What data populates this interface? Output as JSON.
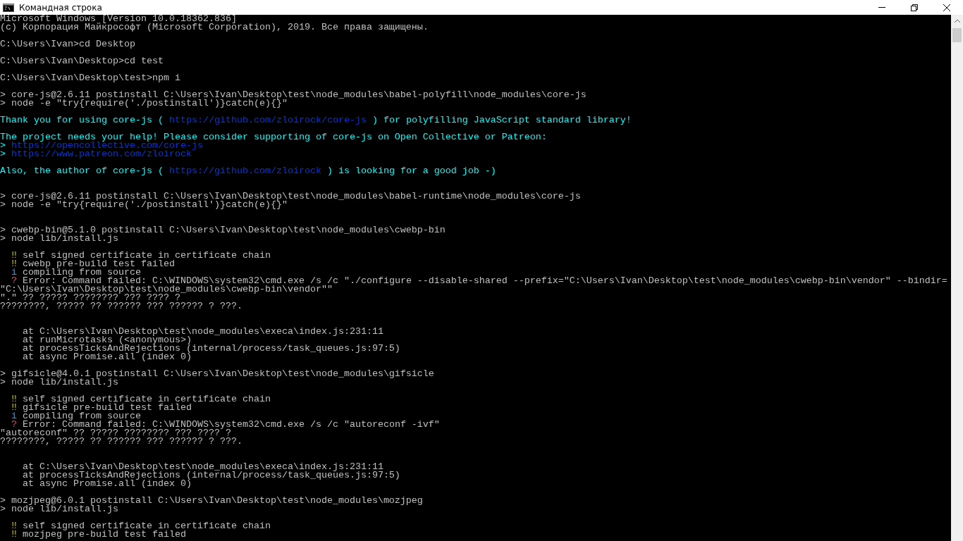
{
  "window": {
    "title": "Командная строка"
  },
  "console": {
    "lines": [
      {
        "kind": "text",
        "segments": [
          {
            "kind": "plain",
            "text": "Microsoft Windows [Version 10.0.18362.836]"
          }
        ]
      },
      {
        "kind": "text",
        "segments": [
          {
            "kind": "plain",
            "text": "(c) Корпорация Майкрософт (Microsoft Corporation), 2019. Все права защищены."
          }
        ]
      },
      {
        "kind": "blank"
      },
      {
        "kind": "text",
        "segments": [
          {
            "kind": "plain",
            "text": "C:\\Users\\Ivan>cd Desktop"
          }
        ]
      },
      {
        "kind": "blank"
      },
      {
        "kind": "text",
        "segments": [
          {
            "kind": "plain",
            "text": "C:\\Users\\Ivan\\Desktop>cd test"
          }
        ]
      },
      {
        "kind": "blank"
      },
      {
        "kind": "text",
        "segments": [
          {
            "kind": "plain",
            "text": "C:\\Users\\Ivan\\Desktop\\test>npm i"
          }
        ]
      },
      {
        "kind": "blank"
      },
      {
        "kind": "text",
        "segments": [
          {
            "kind": "plain",
            "text": "> core-js@2.6.11 postinstall C:\\Users\\Ivan\\Desktop\\test\\node_modules\\babel-polyfill\\node_modules\\core-js"
          }
        ]
      },
      {
        "kind": "text",
        "segments": [
          {
            "kind": "plain",
            "text": "> node -e \"try{require('./postinstall')}catch(e){}\""
          }
        ]
      },
      {
        "kind": "blank"
      },
      {
        "kind": "text",
        "segments": [
          {
            "kind": "cyan",
            "text": "Thank you for using core-js ( "
          },
          {
            "kind": "link",
            "text": "https://github.com/zloirock/core-js"
          },
          {
            "kind": "cyan",
            "text": " ) for polyfilling JavaScript standard library!"
          }
        ]
      },
      {
        "kind": "blank"
      },
      {
        "kind": "text",
        "segments": [
          {
            "kind": "cyan",
            "text": "The project needs your help! Please consider supporting of core-js on Open Collective or Patreon:"
          }
        ]
      },
      {
        "kind": "text",
        "segments": [
          {
            "kind": "cyan",
            "text": "> "
          },
          {
            "kind": "link",
            "text": "https://opencollective.com/core-js"
          }
        ]
      },
      {
        "kind": "text",
        "segments": [
          {
            "kind": "cyan",
            "text": "> "
          },
          {
            "kind": "link",
            "text": "https://www.patreon.com/zloirock"
          }
        ]
      },
      {
        "kind": "blank"
      },
      {
        "kind": "text",
        "segments": [
          {
            "kind": "cyan",
            "text": "Also, the author of core-js ( "
          },
          {
            "kind": "link",
            "text": "https://github.com/zloirock"
          },
          {
            "kind": "cyan",
            "text": " ) is looking for a good job -)"
          }
        ]
      },
      {
        "kind": "blank"
      },
      {
        "kind": "blank"
      },
      {
        "kind": "text",
        "segments": [
          {
            "kind": "plain",
            "text": "> core-js@2.6.11 postinstall C:\\Users\\Ivan\\Desktop\\test\\node_modules\\babel-runtime\\node_modules\\core-js"
          }
        ]
      },
      {
        "kind": "text",
        "segments": [
          {
            "kind": "plain",
            "text": "> node -e \"try{require('./postinstall')}catch(e){}\""
          }
        ]
      },
      {
        "kind": "blank"
      },
      {
        "kind": "blank"
      },
      {
        "kind": "text",
        "segments": [
          {
            "kind": "plain",
            "text": "> cwebp-bin@5.1.0 postinstall C:\\Users\\Ivan\\Desktop\\test\\node_modules\\cwebp-bin"
          }
        ]
      },
      {
        "kind": "text",
        "segments": [
          {
            "kind": "plain",
            "text": "> node lib/install.js"
          }
        ]
      },
      {
        "kind": "blank"
      },
      {
        "kind": "text",
        "segments": [
          {
            "kind": "warn",
            "text": "‼"
          },
          {
            "kind": "plain",
            "text": "self signed certificate in certificate chain"
          }
        ]
      },
      {
        "kind": "text",
        "segments": [
          {
            "kind": "warn",
            "text": "‼"
          },
          {
            "kind": "plain",
            "text": "cwebp pre-build test failed"
          }
        ]
      },
      {
        "kind": "text",
        "segments": [
          {
            "kind": "info",
            "text": "i"
          },
          {
            "kind": "plain",
            "text": "compiling from source"
          }
        ]
      },
      {
        "kind": "text",
        "segments": [
          {
            "kind": "error",
            "text": "?"
          },
          {
            "kind": "plain",
            "text": "Error: Command failed: C:\\WINDOWS\\system32\\cmd.exe /s /c \"./configure --disable-shared --prefix=\"C:\\Users\\Ivan\\Desktop\\test\\node_modules\\cwebp-bin\\vendor\" --bindir="
          }
        ]
      },
      {
        "kind": "text",
        "segments": [
          {
            "kind": "plain",
            "text": "\"C:\\Users\\Ivan\\Desktop\\test\\node_modules\\cwebp-bin\\vendor\"\""
          }
        ]
      },
      {
        "kind": "text",
        "segments": [
          {
            "kind": "plain",
            "text": "\".\" ?? ????? ???????? ??? ???? ?"
          }
        ]
      },
      {
        "kind": "text",
        "segments": [
          {
            "kind": "plain",
            "text": "????????, ????? ?? ?????? ??? ?????? ? ???."
          }
        ]
      },
      {
        "kind": "blank"
      },
      {
        "kind": "blank"
      },
      {
        "kind": "text",
        "segments": [
          {
            "kind": "plain",
            "text": "    at C:\\Users\\Ivan\\Desktop\\test\\node_modules\\execa\\index.js:231:11"
          }
        ]
      },
      {
        "kind": "text",
        "segments": [
          {
            "kind": "plain",
            "text": "    at runMicrotasks (<anonymous>)"
          }
        ]
      },
      {
        "kind": "text",
        "segments": [
          {
            "kind": "plain",
            "text": "    at processTicksAndRejections (internal/process/task_queues.js:97:5)"
          }
        ]
      },
      {
        "kind": "text",
        "segments": [
          {
            "kind": "plain",
            "text": "    at async Promise.all (index 0)"
          }
        ]
      },
      {
        "kind": "blank"
      },
      {
        "kind": "text",
        "segments": [
          {
            "kind": "plain",
            "text": "> gifsicle@4.0.1 postinstall C:\\Users\\Ivan\\Desktop\\test\\node_modules\\gifsicle"
          }
        ]
      },
      {
        "kind": "text",
        "segments": [
          {
            "kind": "plain",
            "text": "> node lib/install.js"
          }
        ]
      },
      {
        "kind": "blank"
      },
      {
        "kind": "text",
        "segments": [
          {
            "kind": "warn",
            "text": "‼"
          },
          {
            "kind": "plain",
            "text": "self signed certificate in certificate chain"
          }
        ]
      },
      {
        "kind": "text",
        "segments": [
          {
            "kind": "warn",
            "text": "‼"
          },
          {
            "kind": "plain",
            "text": "gifsicle pre-build test failed"
          }
        ]
      },
      {
        "kind": "text",
        "segments": [
          {
            "kind": "info",
            "text": "i"
          },
          {
            "kind": "plain",
            "text": "compiling from source"
          }
        ]
      },
      {
        "kind": "text",
        "segments": [
          {
            "kind": "error",
            "text": "?"
          },
          {
            "kind": "plain",
            "text": "Error: Command failed: C:\\WINDOWS\\system32\\cmd.exe /s /c \"autoreconf -ivf\""
          }
        ]
      },
      {
        "kind": "text",
        "segments": [
          {
            "kind": "plain",
            "text": "\"autoreconf\" ?? ????? ???????? ??? ???? ?"
          }
        ]
      },
      {
        "kind": "text",
        "segments": [
          {
            "kind": "plain",
            "text": "????????, ????? ?? ?????? ??? ?????? ? ???."
          }
        ]
      },
      {
        "kind": "blank"
      },
      {
        "kind": "blank"
      },
      {
        "kind": "text",
        "segments": [
          {
            "kind": "plain",
            "text": "    at C:\\Users\\Ivan\\Desktop\\test\\node_modules\\execa\\index.js:231:11"
          }
        ]
      },
      {
        "kind": "text",
        "segments": [
          {
            "kind": "plain",
            "text": "    at processTicksAndRejections (internal/process/task_queues.js:97:5)"
          }
        ]
      },
      {
        "kind": "text",
        "segments": [
          {
            "kind": "plain",
            "text": "    at async Promise.all (index 0)"
          }
        ]
      },
      {
        "kind": "blank"
      },
      {
        "kind": "text",
        "segments": [
          {
            "kind": "plain",
            "text": "> mozjpeg@6.0.1 postinstall C:\\Users\\Ivan\\Desktop\\test\\node_modules\\mozjpeg"
          }
        ]
      },
      {
        "kind": "text",
        "segments": [
          {
            "kind": "plain",
            "text": "> node lib/install.js"
          }
        ]
      },
      {
        "kind": "blank"
      },
      {
        "kind": "text",
        "segments": [
          {
            "kind": "warn",
            "text": "‼"
          },
          {
            "kind": "plain",
            "text": "self signed certificate in certificate chain"
          }
        ]
      },
      {
        "kind": "text",
        "segments": [
          {
            "kind": "warn",
            "text": "‼"
          },
          {
            "kind": "plain",
            "text": "mozjpeg pre-build test failed"
          }
        ]
      }
    ]
  }
}
